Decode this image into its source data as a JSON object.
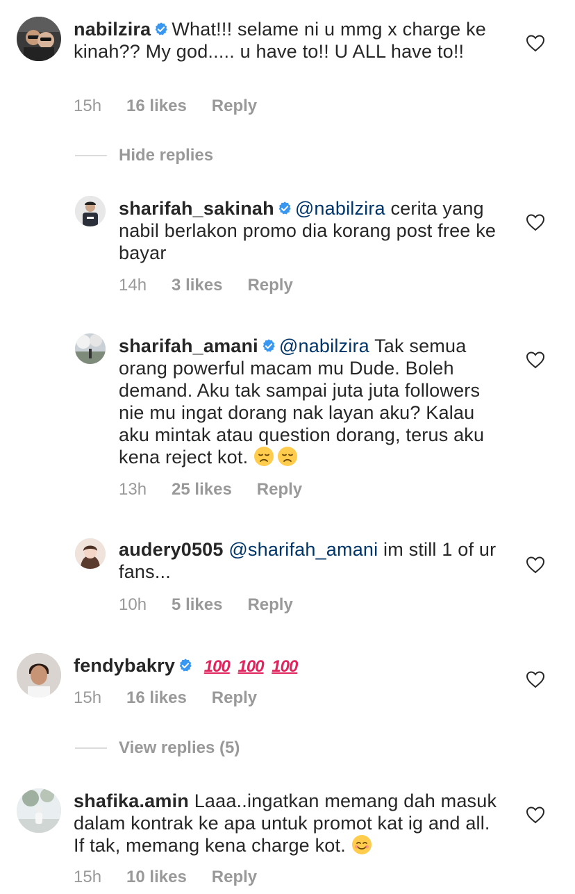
{
  "colors": {
    "text": "#262626",
    "muted": "#999999",
    "mention": "#003569",
    "verified": "#3897f0",
    "emoji": "#ffcc4d"
  },
  "comments": [
    {
      "username": "nabilzira",
      "verified": true,
      "text": "What!!! selame ni u mmg x charge ke kinah?? My god..... u have to!! U ALL have to!!",
      "time": "15h",
      "likes": "16 likes",
      "reply": "Reply",
      "toggle": "Hide replies",
      "replies": [
        {
          "username": "sharifah_sakinah",
          "verified": true,
          "mention": "@nabilzira",
          "text": " cerita yang nabil berlakon promo dia korang post free ke bayar",
          "time": "14h",
          "likes": "3 likes",
          "reply": "Reply"
        },
        {
          "username": "sharifah_amani",
          "verified": true,
          "mention": "@nabilzira",
          "text": " Tak semua orang powerful macam mu Dude. Boleh demand. Aku tak sampai juta juta followers nie mu ingat dorang nak layan aku? Kalau aku mintak atau question dorang, terus aku kena reject kot.",
          "emoji": "disappointed-face ×2",
          "time": "13h",
          "likes": "25 likes",
          "reply": "Reply"
        },
        {
          "username": "audery0505",
          "verified": false,
          "mention": "@sharifah_amani",
          "text": " im still 1 of ur fans...",
          "time": "10h",
          "likes": "5 likes",
          "reply": "Reply"
        }
      ]
    },
    {
      "username": "fendybakry",
      "verified": true,
      "text": "100 100 100",
      "emoji": "hundred-points ×3",
      "time": "15h",
      "likes": "16 likes",
      "reply": "Reply",
      "toggle": "View replies (5)"
    },
    {
      "username": "shafika.amin",
      "verified": false,
      "text": "Laaa..ingatkan memang dah masuk dalam kontrak ke apa untuk promot kat ig and all. If tak, memang kena charge kot.",
      "emoji": "smiling-face",
      "time": "15h",
      "likes": "10 likes",
      "reply": "Reply"
    }
  ]
}
